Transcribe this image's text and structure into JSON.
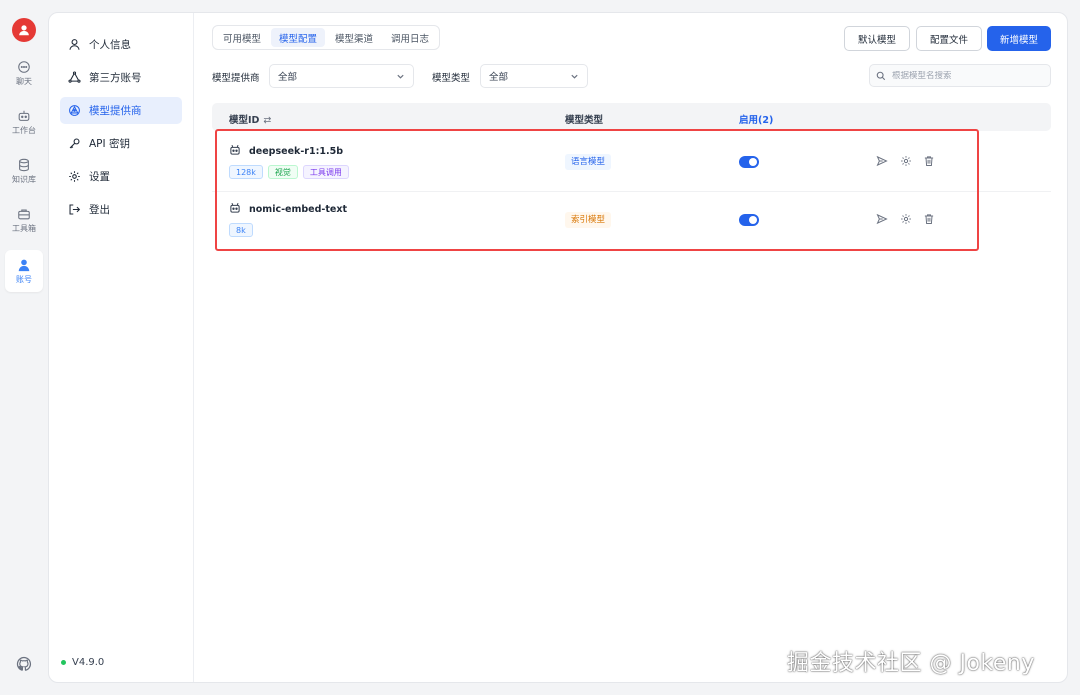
{
  "rail": {
    "items": [
      {
        "label": "聊天",
        "icon": "chat-icon"
      },
      {
        "label": "工作台",
        "icon": "robot-icon"
      },
      {
        "label": "知识库",
        "icon": "database-icon"
      },
      {
        "label": "工具箱",
        "icon": "toolbox-icon"
      },
      {
        "label": "账号",
        "icon": "user-icon"
      }
    ],
    "active_index": 4
  },
  "sidebar": {
    "items": [
      {
        "label": "个人信息",
        "icon": "user-icon"
      },
      {
        "label": "第三方账号",
        "icon": "triangle-nodes-icon"
      },
      {
        "label": "模型提供商",
        "icon": "provider-icon"
      },
      {
        "label": "API 密钥",
        "icon": "key-icon"
      },
      {
        "label": "设置",
        "icon": "gear-icon"
      },
      {
        "label": "登出",
        "icon": "logout-icon"
      }
    ],
    "active_index": 2,
    "version": "V4.9.0"
  },
  "tabs": [
    "可用模型",
    "模型配置",
    "模型渠道",
    "调用日志"
  ],
  "active_tab": 1,
  "toolbar": {
    "default_model": "默认模型",
    "config_file": "配置文件",
    "add_model": "新增模型"
  },
  "filters": {
    "provider_label": "模型提供商",
    "provider_value": "全部",
    "type_label": "模型类型",
    "type_value": "全部",
    "search_placeholder": "根据模型名搜索"
  },
  "table": {
    "headers": {
      "model_id": "模型ID",
      "swap_symbol": "⇄",
      "model_type": "模型类型",
      "enabled": "启用(2)"
    },
    "rows": [
      {
        "name": "deepseek-r1:1.5b",
        "tags": [
          "128k",
          "视觉",
          "工具调用"
        ],
        "type": "语言模型",
        "enabled": true
      },
      {
        "name": "nomic-embed-text",
        "tags": [
          "8k"
        ],
        "type": "索引模型",
        "enabled": true
      }
    ]
  },
  "watermark": "掘金技术社区 @ Jokeny",
  "colors": {
    "accent": "#2563eb",
    "highlight": "#ef4444",
    "avatar": "#e53935",
    "status_dot": "#22c55e"
  }
}
